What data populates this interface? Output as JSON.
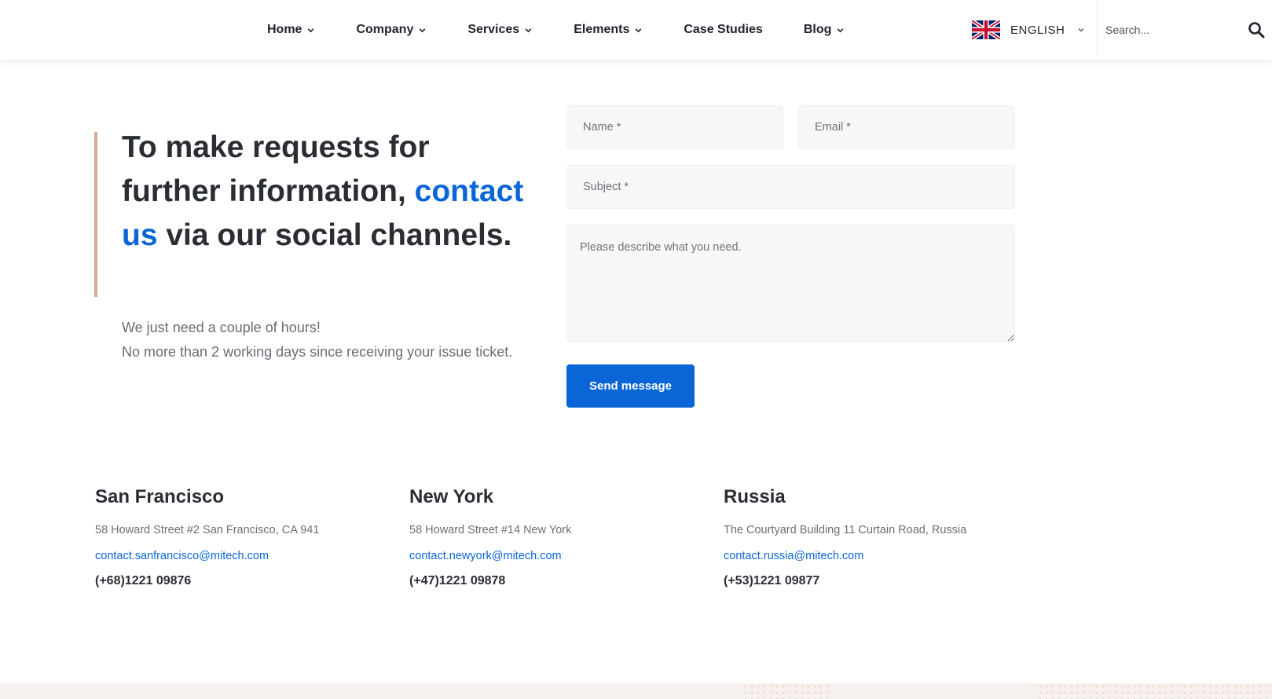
{
  "nav": {
    "items": [
      {
        "label": "Home",
        "has_dropdown": true
      },
      {
        "label": "Company",
        "has_dropdown": true
      },
      {
        "label": "Services",
        "has_dropdown": true
      },
      {
        "label": "Elements",
        "has_dropdown": true
      },
      {
        "label": "Case Studies",
        "has_dropdown": false
      },
      {
        "label": "Blog",
        "has_dropdown": true
      }
    ],
    "language": {
      "label": "ENGLISH",
      "flag": "uk-flag-icon"
    },
    "search": {
      "placeholder": "Search...",
      "icon": "search-icon"
    }
  },
  "intro": {
    "title_part1": "To make requests for further information,",
    "title_highlight": "contact us",
    "title_part2": "via our social channels.",
    "sub_line1": "We just need a couple of hours!",
    "sub_line2": "No more than 2 working days since receiving your issue ticket."
  },
  "form": {
    "name_placeholder": "Name *",
    "email_placeholder": "Email *",
    "subject_placeholder": "Subject *",
    "message_placeholder": "Please describe what you need.",
    "submit_label": "Send message"
  },
  "offices": [
    {
      "city": "San Francisco",
      "address": "58 Howard Street #2 San Francisco, CA 941",
      "email": "contact.sanfrancisco@mitech.com",
      "phone": "(+68)1221 09876"
    },
    {
      "city": "New York",
      "address": "58 Howard Street #14 New York",
      "email": "contact.newyork@mitech.com",
      "phone": "(+47)1221 09878"
    },
    {
      "city": "Russia",
      "address": "The Courtyard Building 11 Curtain Road, Russia",
      "email": "contact.russia@mitech.com",
      "phone": "(+53)1221 09877"
    }
  ],
  "colors": {
    "accent": "#0a66d6",
    "bar": "#d7aa91",
    "footer": "#f6f1ee"
  }
}
